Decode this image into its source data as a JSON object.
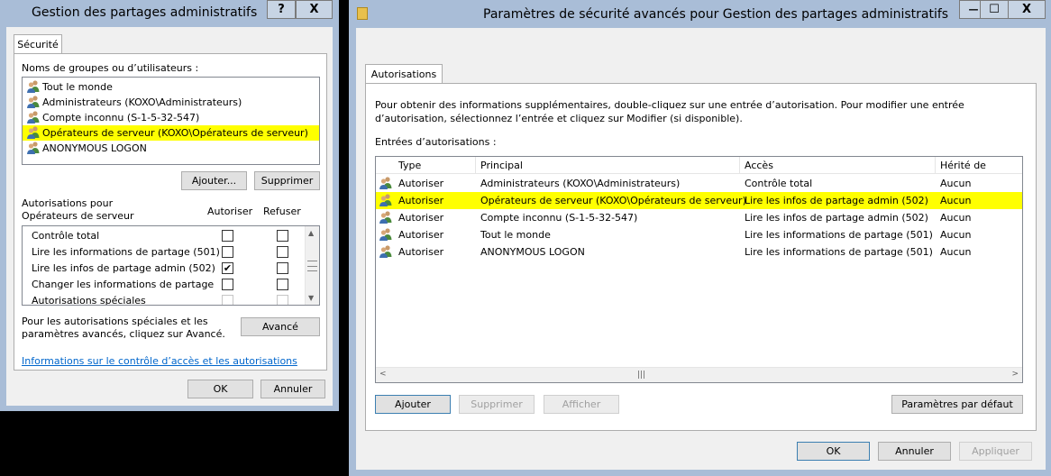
{
  "dialog": {
    "title": "Gestion des partages administratifs",
    "help_button": "?",
    "close_button": "X",
    "tab_security": "Sécurité",
    "groups_label": "Noms de groupes ou d’utilisateurs :",
    "groups": [
      {
        "label": "Tout le monde",
        "highlighted": false
      },
      {
        "label": "Administrateurs (KOXO\\Administrateurs)",
        "highlighted": false
      },
      {
        "label": "Compte inconnu (S-1-5-32-547)",
        "highlighted": false
      },
      {
        "label": "Opérateurs de serveur (KOXO\\Opérateurs de serveur)",
        "highlighted": true
      },
      {
        "label": "ANONYMOUS LOGON",
        "highlighted": false
      }
    ],
    "add_button": "Ajouter...",
    "remove_button": "Supprimer",
    "permissions_label": "Autorisations pour Opérateurs de serveur",
    "allow_header": "Autoriser",
    "deny_header": "Refuser",
    "permissions": [
      {
        "label": "Contrôle total",
        "allow": false,
        "deny": false,
        "enabled": true
      },
      {
        "label": "Lire les informations de partage (501)",
        "allow": false,
        "deny": false,
        "enabled": true
      },
      {
        "label": "Lire les infos de partage admin (502)",
        "allow": true,
        "deny": false,
        "enabled": true
      },
      {
        "label": "Changer les informations de partage",
        "allow": false,
        "deny": false,
        "enabled": true
      },
      {
        "label": "Autorisations spéciales",
        "allow": false,
        "deny": false,
        "enabled": false
      }
    ],
    "check_mark": "✔",
    "advanced_text": "Pour les autorisations spéciales et les paramètres avancés, cliquez sur Avancé.",
    "advanced_button": "Avancé",
    "link_text": "Informations sur le contrôle d’accès et les autorisations",
    "ok_button": "OK",
    "cancel_button": "Annuler"
  },
  "advanced": {
    "title": "Paramètres de sécurité avancés pour Gestion des partages administratifs",
    "minimize_button": "—",
    "maximize_button": "☐",
    "close_button": "X",
    "tab_permissions": "Autorisations",
    "info_text": "Pour obtenir des informations supplémentaires, double-cliquez sur une entrée d’autorisation. Pour modifier une entrée d’autorisation, sélectionnez l’entrée et cliquez sur Modifier (si disponible).",
    "entries_label": "Entrées d’autorisations :",
    "columns": {
      "type": "Type",
      "principal": "Principal",
      "access": "Accès",
      "inherited": "Hérité de"
    },
    "entries": [
      {
        "type": "Autoriser",
        "principal": "Administrateurs (KOXO\\Administrateurs)",
        "access": "Contrôle total",
        "inherited": "Aucun",
        "highlighted": false
      },
      {
        "type": "Autoriser",
        "principal": "Opérateurs de serveur (KOXO\\Opérateurs de serveur)",
        "access": "Lire les infos de partage admin (502)",
        "inherited": "Aucun",
        "highlighted": true
      },
      {
        "type": "Autoriser",
        "principal": "Compte inconnu (S-1-5-32-547)",
        "access": "Lire les infos de partage admin (502)",
        "inherited": "Aucun",
        "highlighted": false
      },
      {
        "type": "Autoriser",
        "principal": "Tout le monde",
        "access": "Lire les informations de partage (501)",
        "inherited": "Aucun",
        "highlighted": false
      },
      {
        "type": "Autoriser",
        "principal": "ANONYMOUS LOGON",
        "access": "Lire les informations de partage (501)",
        "inherited": "Aucun",
        "highlighted": false
      }
    ],
    "add_button": "Ajouter",
    "remove_button": "Supprimer",
    "view_button": "Afficher",
    "defaults_button": "Paramètres par défaut",
    "ok_button": "OK",
    "cancel_button": "Annuler",
    "apply_button": "Appliquer"
  },
  "colors": {
    "highlight": "#ffff00",
    "link": "#0066cc",
    "frame": "#a9bdd7"
  }
}
